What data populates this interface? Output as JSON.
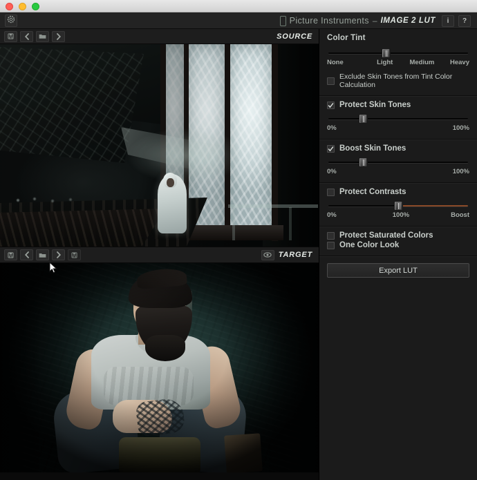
{
  "window": {
    "os_controls": [
      "close",
      "minimize",
      "maximize"
    ],
    "gear_icon": "gear-icon",
    "brand_name": "Picture Instruments",
    "brand_separator": "–",
    "product_name": "IMAGE 2 LUT",
    "info_label": "i",
    "help_label": "?"
  },
  "source_pane": {
    "label": "SOURCE",
    "toolbar": [
      {
        "name": "save-preset-icon",
        "glyph": "save"
      },
      {
        "name": "previous-image-icon",
        "glyph": "chevron-left"
      },
      {
        "name": "open-folder-icon",
        "glyph": "folder"
      },
      {
        "name": "next-image-icon",
        "glyph": "chevron-right"
      }
    ]
  },
  "target_pane": {
    "label": "TARGET",
    "eye_icon": "eye-icon",
    "toolbar": [
      {
        "name": "save-preset-icon",
        "glyph": "save"
      },
      {
        "name": "previous-image-icon",
        "glyph": "chevron-left"
      },
      {
        "name": "open-folder-icon",
        "glyph": "folder"
      },
      {
        "name": "next-image-icon",
        "glyph": "chevron-right"
      },
      {
        "name": "save-image-icon",
        "glyph": "save"
      }
    ]
  },
  "panel": {
    "color_tint": {
      "title": "Color Tint",
      "slider": {
        "value_percent": 43,
        "ticks": [
          "None",
          "Light",
          "Medium",
          "Heavy"
        ]
      },
      "exclude_checkbox": {
        "label": "Exclude Skin Tones from Tint Color Calculation",
        "checked": false
      }
    },
    "protect_skin_tones": {
      "label": "Protect Skin Tones",
      "checked": true,
      "slider": {
        "value_percent": 26,
        "min_label": "0%",
        "max_label": "100%"
      }
    },
    "boost_skin_tones": {
      "label": "Boost Skin Tones",
      "checked": true,
      "slider": {
        "value_percent": 26,
        "min_label": "0%",
        "max_label": "100%"
      }
    },
    "protect_contrasts": {
      "label": "Protect Contrasts",
      "checked": false,
      "slider": {
        "value_percent": 50,
        "min_label": "0%",
        "mid_label": "100%",
        "max_label": "Boost",
        "hot_color": "#8a4a28"
      }
    },
    "protect_saturated_colors": {
      "label": "Protect Saturated Colors",
      "checked": false
    },
    "one_color_look": {
      "label": "One Color Look",
      "checked": false
    },
    "export_button": {
      "label": "Export LUT"
    }
  },
  "colors": {
    "panel_bg": "#1b1b1b",
    "titlebar_bg": "#232323",
    "text_primary": "#c9cfcb",
    "brand_text": "#98a29b",
    "slider_hot": "#8a4a28"
  }
}
